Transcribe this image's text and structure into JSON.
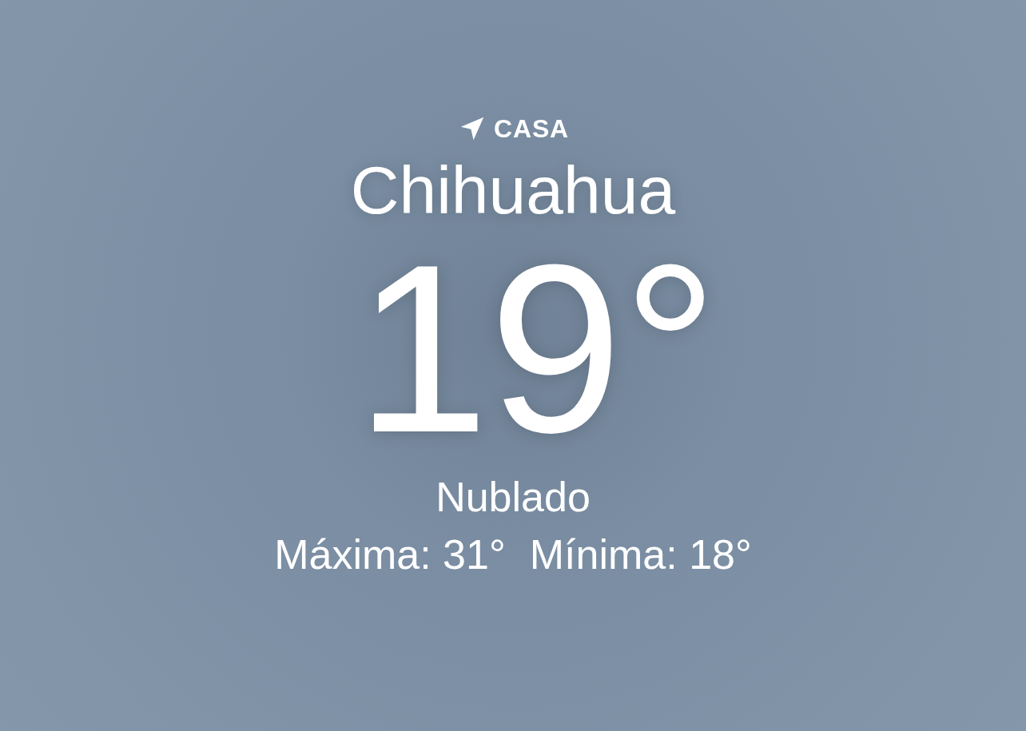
{
  "location_label": "CASA",
  "city": "Chihuahua",
  "temperature": "19°",
  "condition": "Nublado",
  "high": "Máxima: 31°",
  "low": "Mínima: 18°"
}
